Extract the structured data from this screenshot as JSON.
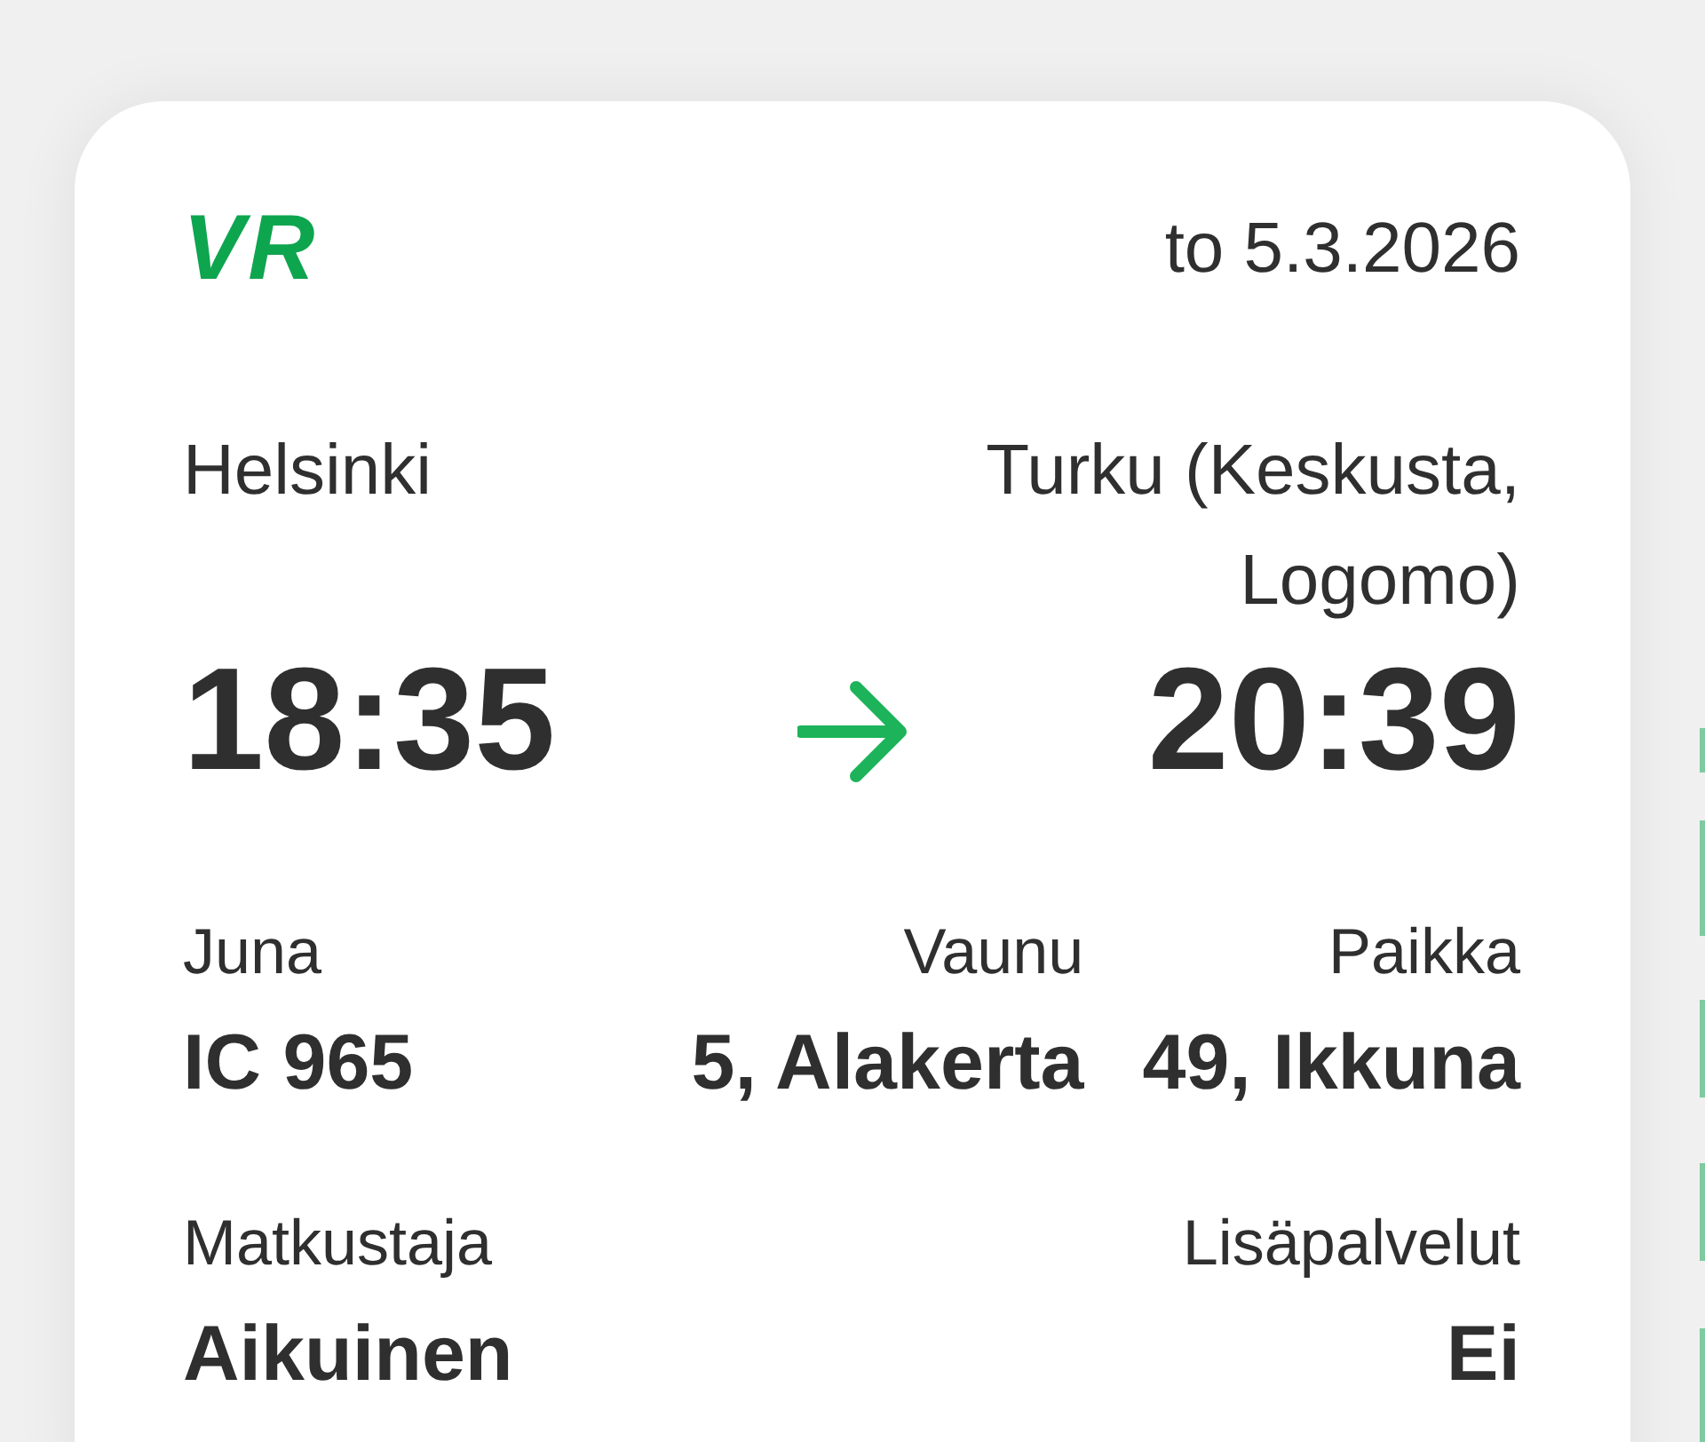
{
  "header": {
    "logo": "VR",
    "date": "to 5.3.2026"
  },
  "route": {
    "origin": {
      "station": "Helsinki",
      "time": "18:35"
    },
    "destination": {
      "station": "Turku (Keskusta, Logomo)",
      "time": "20:39"
    }
  },
  "details": [
    {
      "label": "Juna",
      "value": "IC 965"
    },
    {
      "label": "Vaunu",
      "value": "5, Alakerta"
    },
    {
      "label": "Paikka",
      "value": "49, Ikkuna"
    }
  ],
  "extras": [
    {
      "label": "Matkustaja",
      "value": "Aikuinen"
    },
    {
      "label": "Lisäpalvelut",
      "value": "Ei"
    }
  ]
}
